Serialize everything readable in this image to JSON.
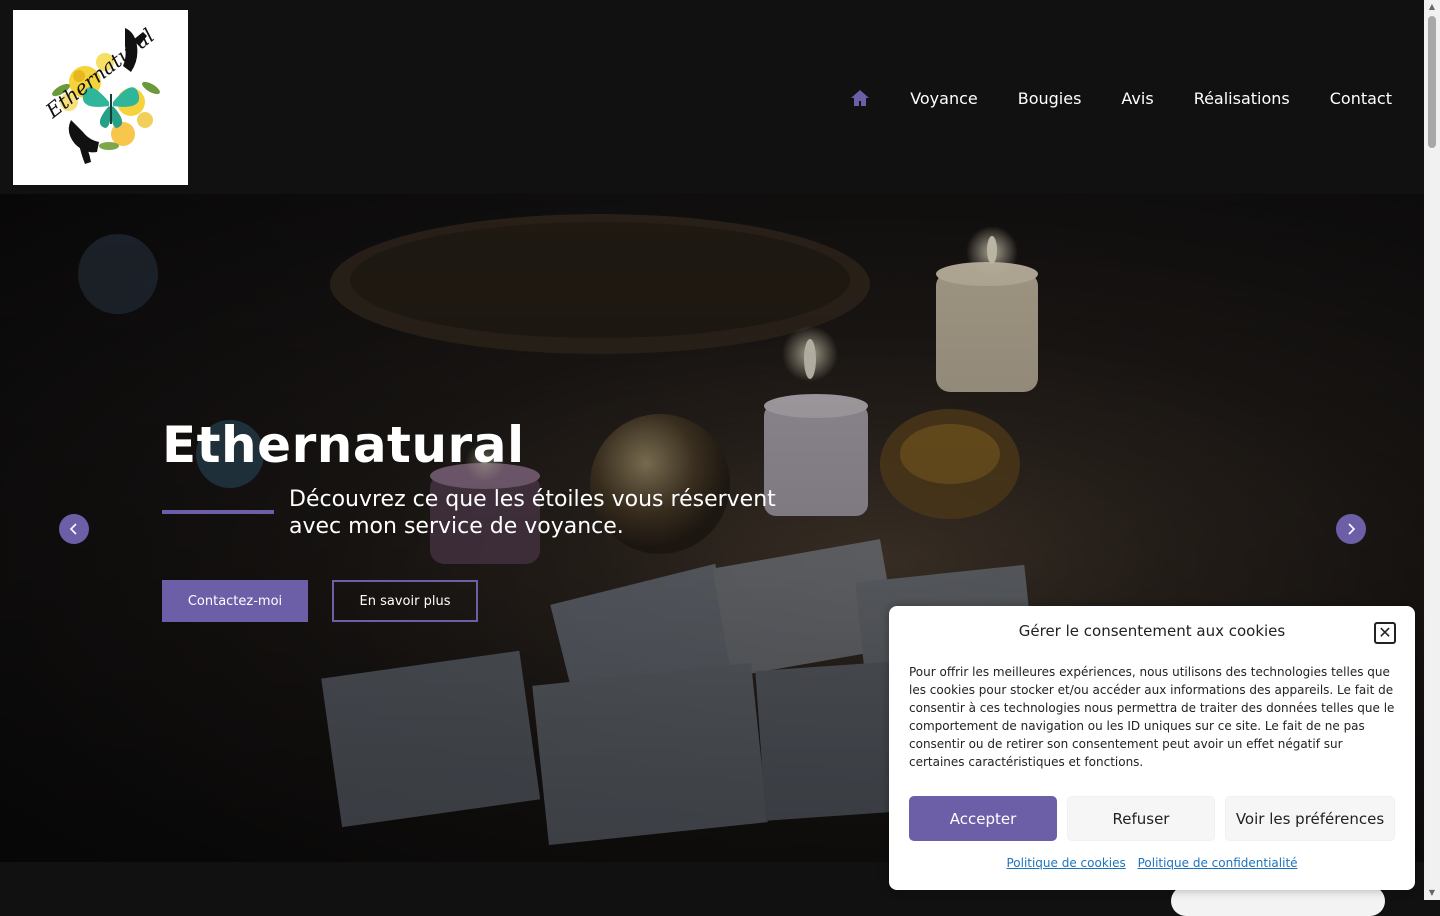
{
  "nav": {
    "items": [
      "Voyance",
      "Bougies",
      "Avis",
      "Réalisations",
      "Contact"
    ],
    "logo_text": "Ethernatural"
  },
  "hero": {
    "title": "Ethernatural",
    "subtitle": "Découvrez ce que les étoiles vous réservent avec mon service de voyance.",
    "primary_button": "Contactez-moi",
    "secondary_button": "En savoir plus"
  },
  "cookie": {
    "title": "Gérer le consentement aux cookies",
    "text": "Pour offrir les meilleures expériences, nous utilisons des technologies telles que les cookies pour stocker et/ou accéder aux informations des appareils. Le fait de consentir à ces technologies nous permettra de traiter des données telles que le comportement de navigation ou les ID uniques sur ce site. Le fait de ne pas consentir ou de retirer son consentement peut avoir un effet négatif sur certaines caractéristiques et fonctions.",
    "accept": "Accepter",
    "refuse": "Refuser",
    "preferences": "Voir les préférences",
    "cookie_policy": "Politique de cookies",
    "privacy_policy": "Politique de confidentialité"
  },
  "colors": {
    "accent": "#6d5ea8",
    "header_bg": "#111111",
    "link": "#1e73be"
  },
  "icons": {
    "home": "home-icon",
    "prev": "chevron-left-icon",
    "next": "chevron-right-icon",
    "close": "close-icon"
  }
}
